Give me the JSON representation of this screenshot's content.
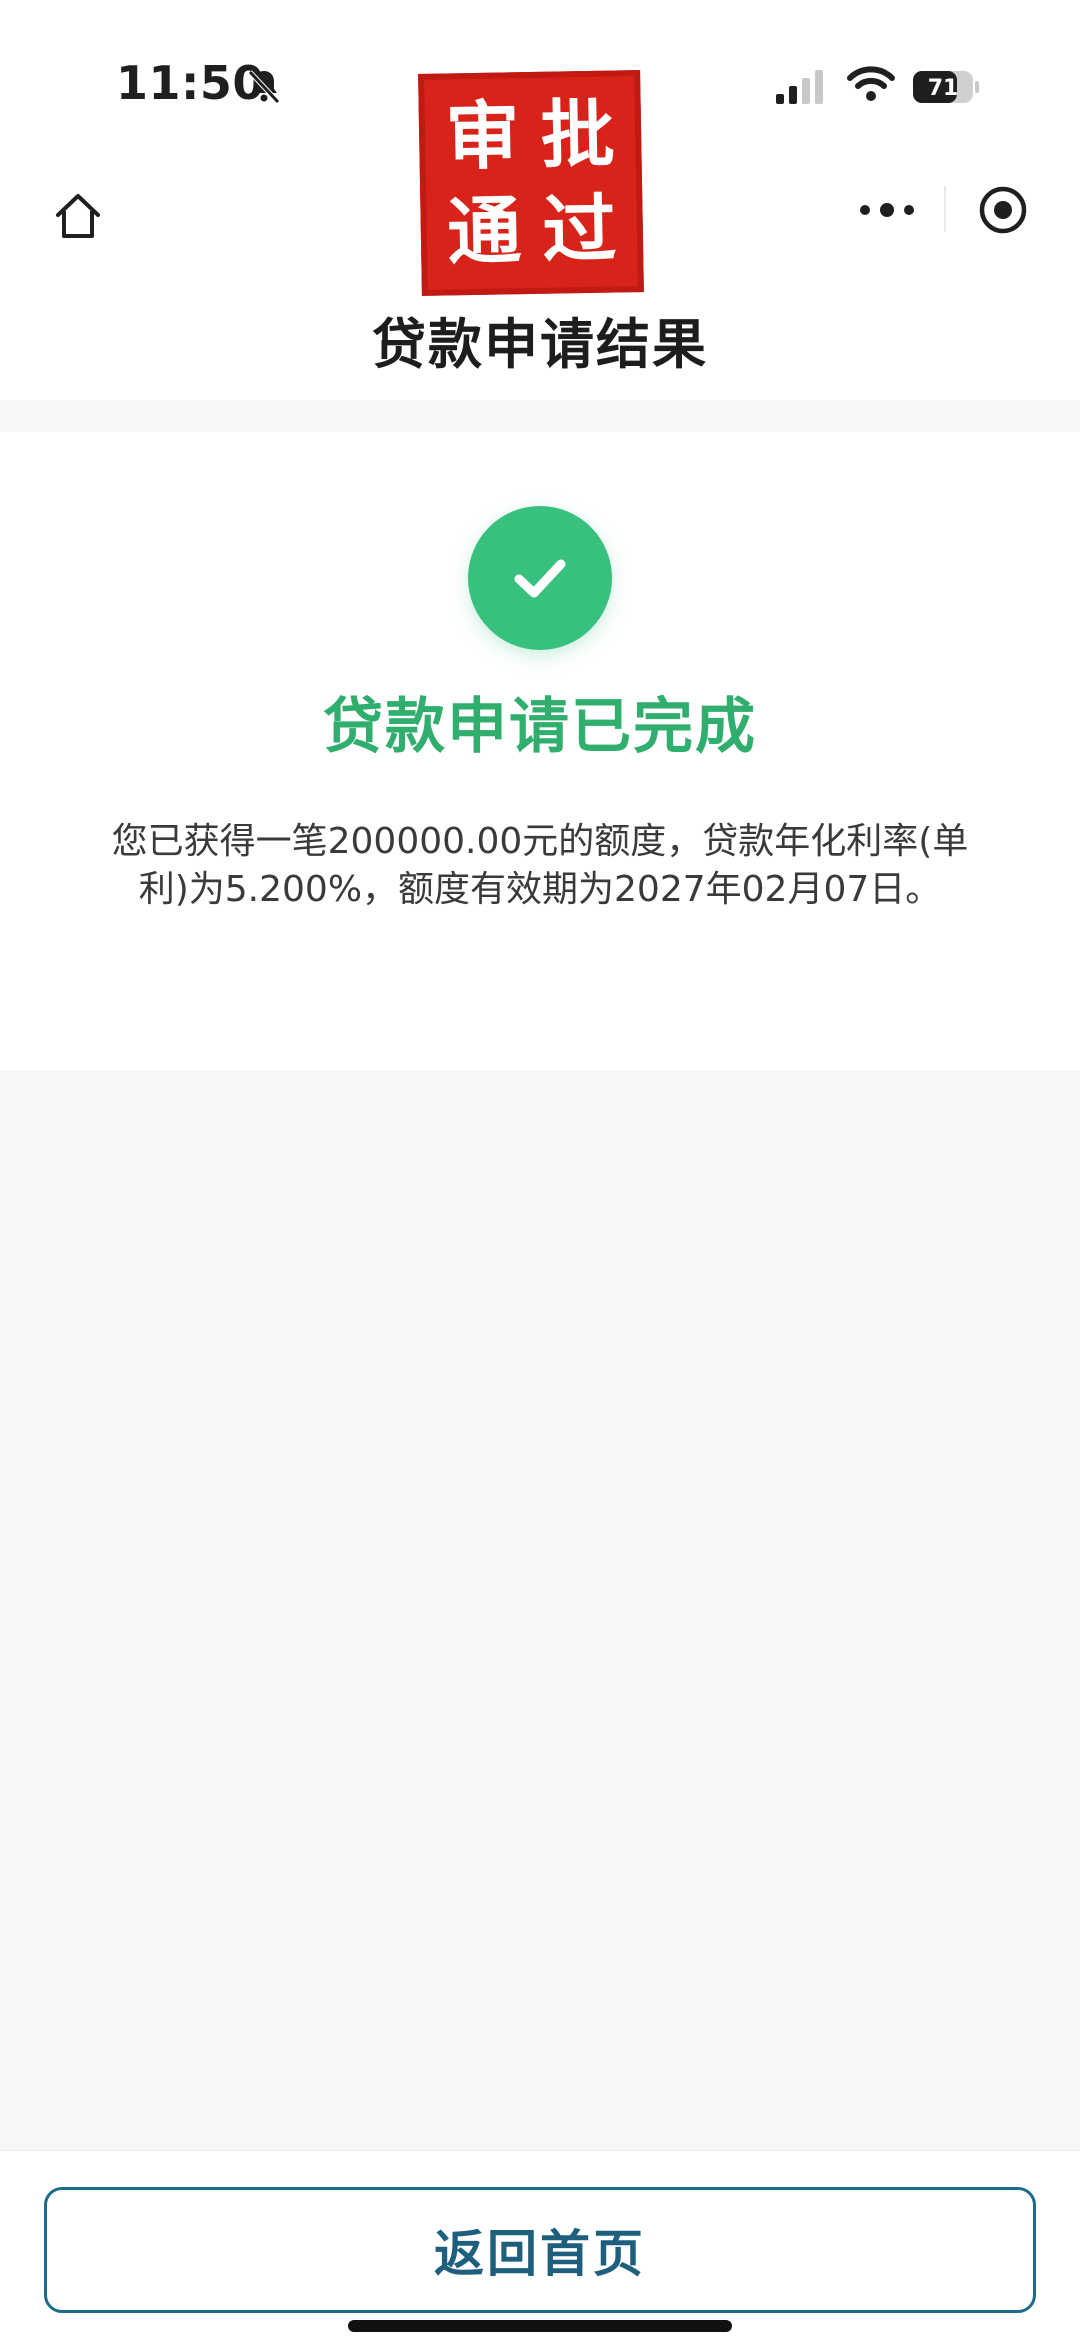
{
  "status_bar": {
    "time": "11:50",
    "battery_level": "71"
  },
  "nav": {
    "title": "贷款申请结果"
  },
  "stamp": {
    "chars": [
      "审",
      "批",
      "通",
      "过"
    ],
    "color": "#d8231b"
  },
  "result": {
    "title": "贷款申请已完成",
    "description": "您已获得一笔200000.00元的额度，贷款年化利率(单利)为5.200%，额度有效期为2027年02月07日。",
    "accent_color": "#38c07e"
  },
  "footer": {
    "button_label": "返回首页"
  },
  "icons": {
    "home": "home-icon",
    "more": "more-dots-icon",
    "close": "target-circle-icon",
    "bell": "bell-muted-icon",
    "signal": "signal-icon",
    "wifi": "wifi-icon",
    "battery": "battery-icon",
    "check": "check-icon"
  }
}
